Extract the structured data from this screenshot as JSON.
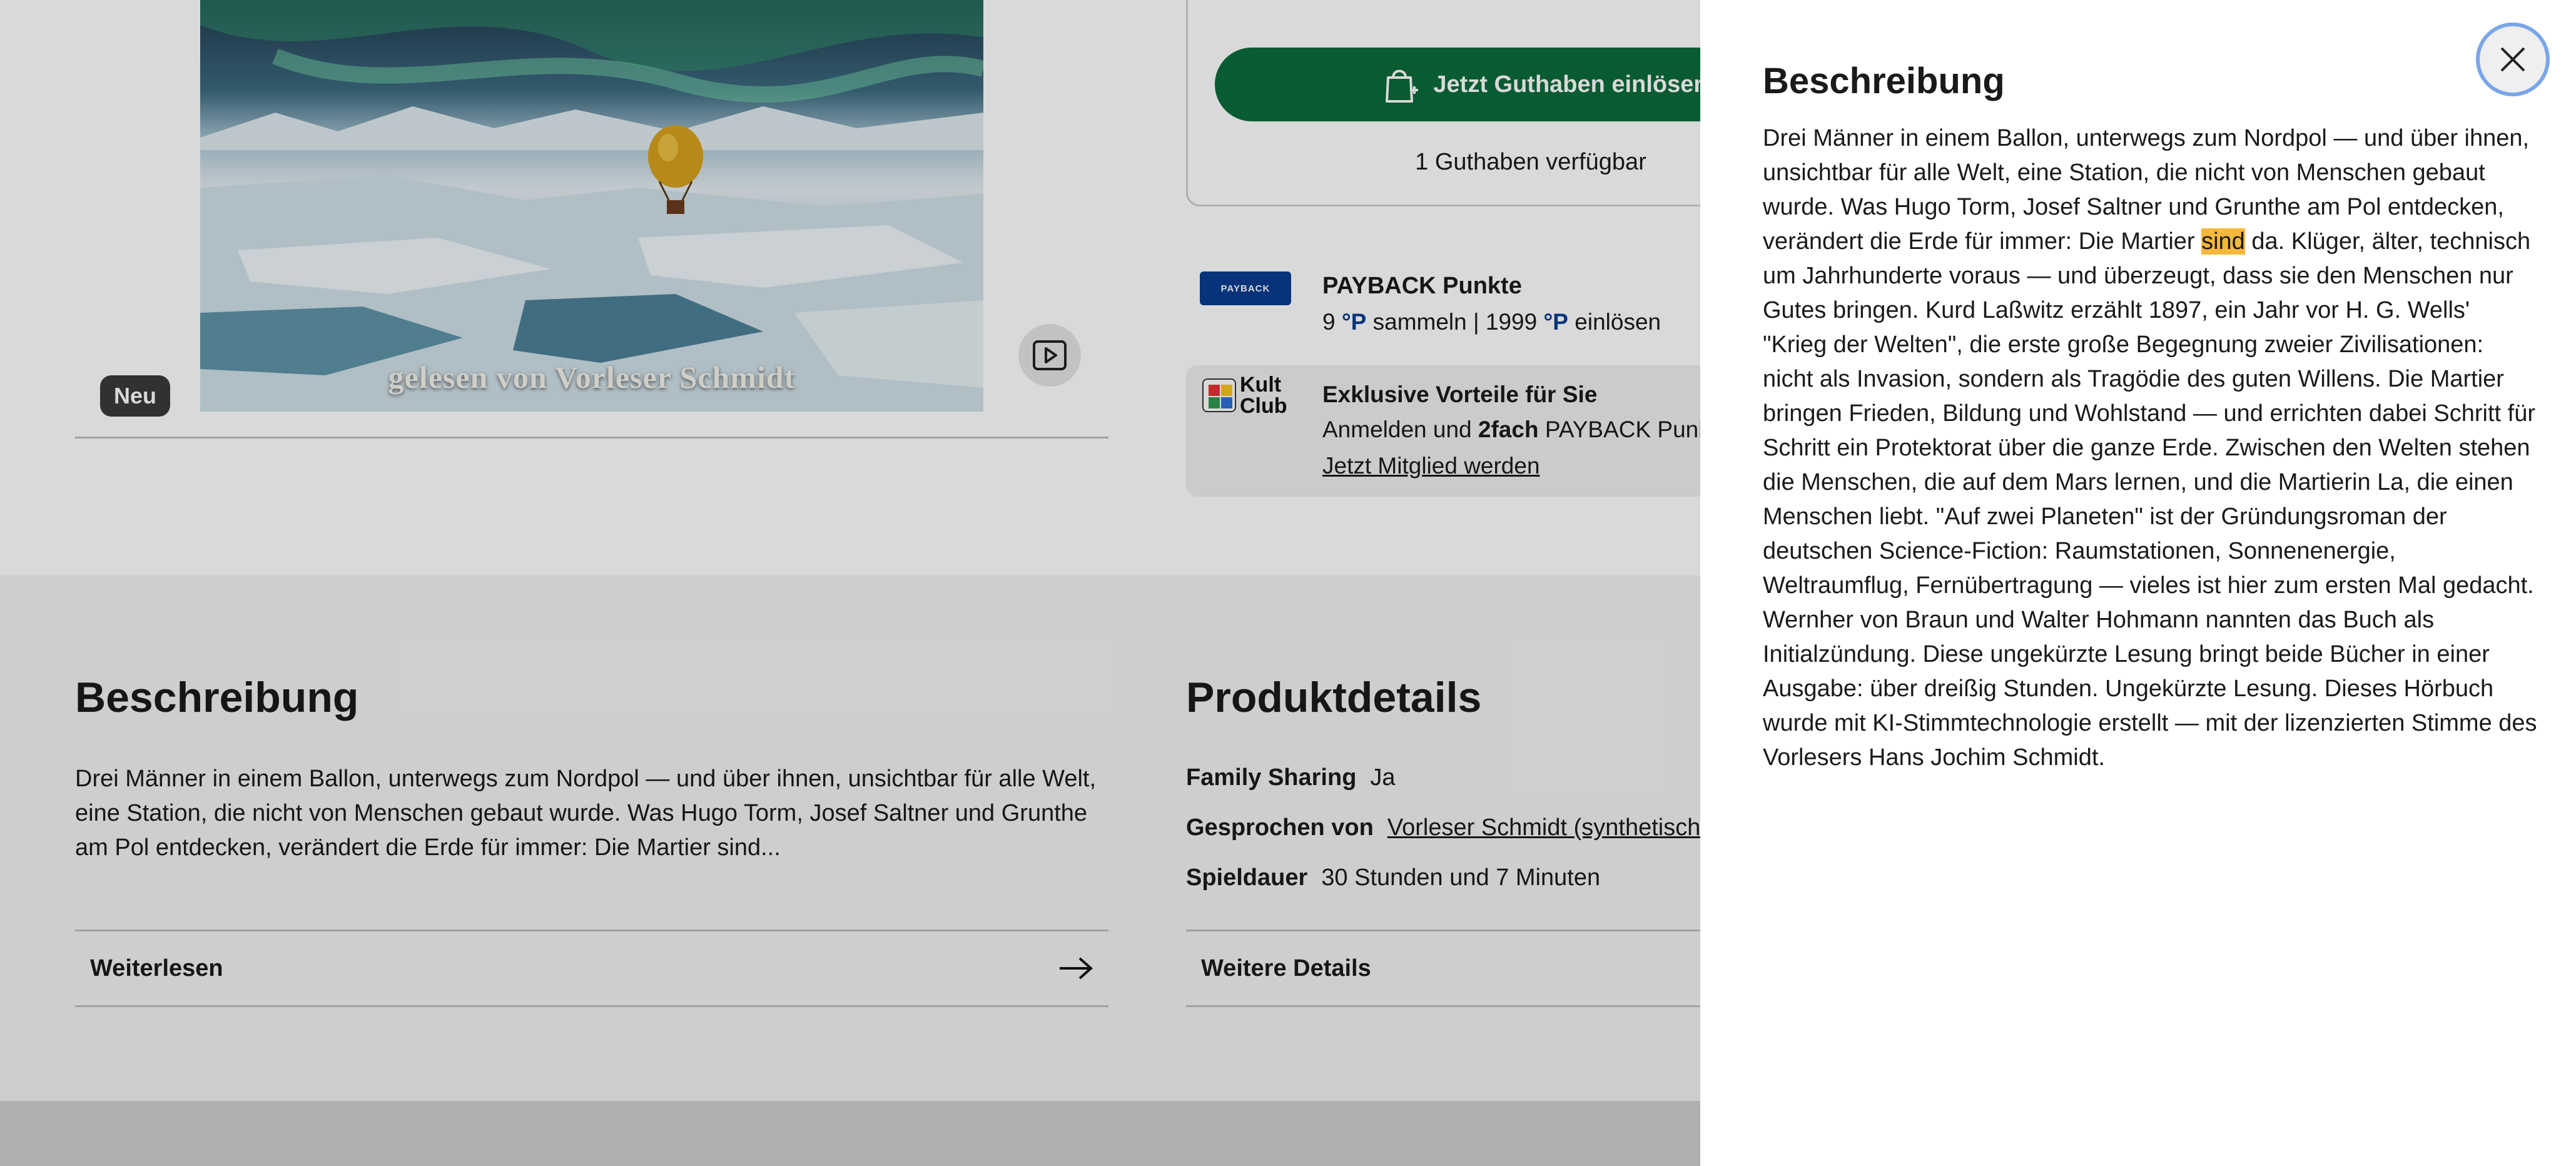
{
  "cover": {
    "caption": "gelesen von Vorleser Schmidt",
    "badge": "Neu"
  },
  "purchase": {
    "redeem_label": "Jetzt Guthaben einlösen",
    "credits_available": "1 Guthaben verfügbar"
  },
  "payback": {
    "logo_text": "PAYBACK",
    "title": "PAYBACK Punkte",
    "collect_points": "9",
    "point_symbol": "°P",
    "collect_label": "sammeln |",
    "redeem_points": "1999",
    "redeem_label": "einlösen"
  },
  "kultclub": {
    "logo_line1": "Kult",
    "logo_line2": "Club",
    "title": "Exklusive Vorteile für Sie",
    "line_prefix": "Anmelden und ",
    "line_bold": "2fach",
    "line_suffix": " PAYBACK Punkt",
    "link": "Jetzt Mitglied werden"
  },
  "description": {
    "title": "Beschreibung",
    "text": "Drei Männer in einem Ballon, unterwegs zum Nordpol — und über ihnen, unsichtbar für alle Welt, eine Station, die nicht von Menschen gebaut wurde. Was Hugo Torm, Josef Saltner und Grunthe am Pol entdecken, verändert die Erde für immer: Die Martier sind...",
    "read_more": "Weiterlesen"
  },
  "product_details": {
    "title": "Produktdetails",
    "family_sharing_label": "Family Sharing",
    "family_sharing_value": "Ja",
    "narrator_label": "Gesprochen von",
    "narrator_value": "Vorleser Schmidt (synthetische S",
    "duration_label": "Spieldauer",
    "duration_value": "30 Stunden und 7 Minuten",
    "more_details": "Weitere Details"
  },
  "drawer": {
    "title": "Beschreibung",
    "text_before": "Drei Männer in einem Ballon, unterwegs zum Nordpol — und über ihnen, unsichtbar für alle Welt, eine Station, die nicht von Menschen gebaut wurde. Was Hugo Torm, Josef Saltner und Grunthe am Pol entdecken, verändert die Erde für immer: Die Martier ",
    "text_highlight": "sind",
    "text_after": " da. Klüger, älter, technisch um Jahrhunderte voraus — und überzeugt, dass sie den Menschen nur Gutes bringen. Kurd Laßwitz erzählt 1897, ein Jahr vor H. G. Wells' \"Krieg der Welten\", die erste große Begegnung zweier Zivilisationen: nicht als Invasion, sondern als Tragödie des guten Willens. Die Martier bringen Frieden, Bildung und Wohlstand — und errichten dabei Schritt für Schritt ein Protektorat über die ganze Erde. Zwischen den Welten stehen die Menschen, die auf dem Mars lernen, und die Martierin La, die einen Menschen liebt. \"Auf zwei Planeten\" ist der Gründungsroman der deutschen Science-Fiction: Raumstationen, Sonnenenergie, Weltraumflug, Fernübertragung — vieles ist hier zum ersten Mal gedacht. Wernher von Braun und Walter Hohmann nannten das Buch als Initialzündung. Diese ungekürzte Lesung bringt beide Bücher in einer Ausgabe: über dreißig Stunden. Ungekürzte Lesung. Dieses Hörbuch wurde mit KI-Stimmtechnologie erstellt — mit der lizenzierten Stimme des Vorlesers Hans Jochim Schmidt."
  },
  "colors": {
    "accent_green": "#0b6b3a",
    "highlight": "#f5b83d",
    "payback_blue": "#0a3d91",
    "focus_ring": "#7aa6e8"
  }
}
